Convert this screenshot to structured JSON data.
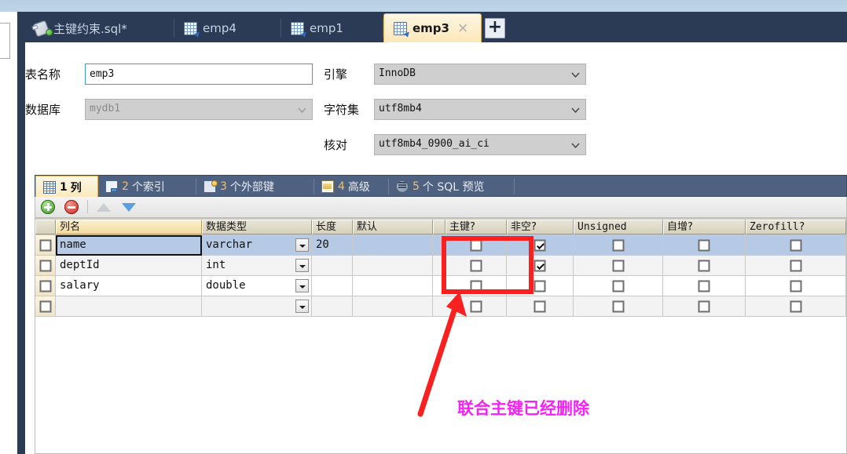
{
  "window": {
    "tabs": [
      {
        "label": "主键约束.sql*",
        "icon": "sql-file-icon",
        "active": false,
        "closable": false
      },
      {
        "label": "emp4",
        "icon": "table-icon",
        "active": false,
        "closable": false
      },
      {
        "label": "emp1",
        "icon": "table-icon",
        "active": false,
        "closable": false
      },
      {
        "label": "emp3",
        "icon": "table-icon",
        "active": true,
        "closable": true,
        "close_label": "×"
      }
    ],
    "add_tab_label": "+"
  },
  "form": {
    "table_name_label": "表名称",
    "table_name_value": "emp3",
    "database_label": "数据库",
    "database_value": "mydb1",
    "engine_label": "引擎",
    "engine_value": "InnoDB",
    "charset_label": "字符集",
    "charset_value": "utf8mb4",
    "collation_label": "核对",
    "collation_value": "utf8mb4_0900_ai_ci"
  },
  "subtabs": [
    {
      "num": "1",
      "label": "列",
      "icon": "columns-grid-icon",
      "active": true
    },
    {
      "num": "2",
      "label": "个索引",
      "icon": "index-icon",
      "active": false
    },
    {
      "num": "3",
      "label": "个外部键",
      "icon": "foreign-key-icon",
      "active": false
    },
    {
      "num": "4",
      "label": "高级",
      "icon": "advanced-icon",
      "active": false
    },
    {
      "num": "5",
      "label": "个 SQL 预览",
      "icon": "sql-preview-icon",
      "active": false
    }
  ],
  "toolbar": {
    "add_label": "add-row",
    "delete_label": "delete-row",
    "move_up_label": "move-up",
    "move_down_label": "move-down"
  },
  "grid": {
    "columns": [
      "列名",
      "数据类型",
      "长度",
      "默认",
      "主键?",
      "非空?",
      "Unsigned",
      "自增?",
      "Zerofill?"
    ],
    "rows": [
      {
        "name": "name",
        "type": "varchar",
        "length": "20",
        "default": "",
        "pk": false,
        "notnull": true,
        "unsigned": false,
        "autoinc": false,
        "zerofill": false,
        "selected": true
      },
      {
        "name": "deptId",
        "type": "int",
        "length": "",
        "default": "",
        "pk": false,
        "notnull": true,
        "unsigned": false,
        "autoinc": false,
        "zerofill": false,
        "selected": false
      },
      {
        "name": "salary",
        "type": "double",
        "length": "",
        "default": "",
        "pk": false,
        "notnull": false,
        "unsigned": false,
        "autoinc": false,
        "zerofill": false,
        "selected": false
      },
      {
        "name": "",
        "type": "",
        "length": "",
        "default": "",
        "pk": false,
        "notnull": false,
        "unsigned": false,
        "autoinc": false,
        "zerofill": false,
        "selected": false
      }
    ]
  },
  "annotation": {
    "text": "联合主键已经删除",
    "text_color": "#f820f8",
    "highlight_color": "#fb2020"
  }
}
